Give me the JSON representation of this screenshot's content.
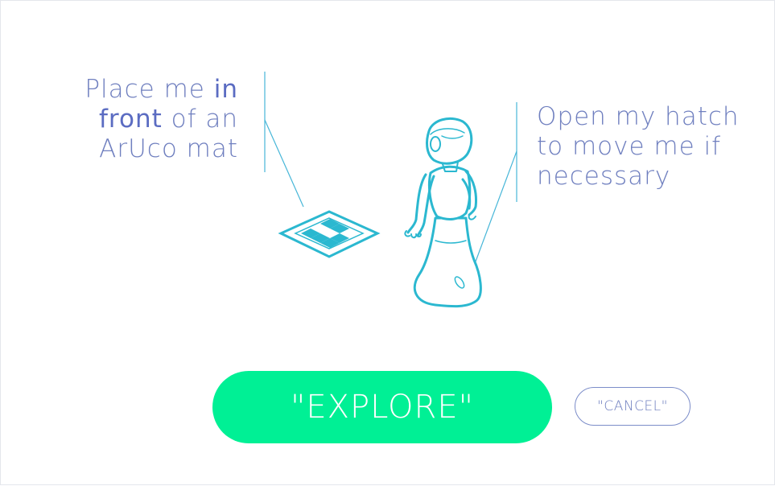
{
  "instructions": {
    "left": {
      "part1": "Place me ",
      "part2": "in",
      "part3": "front",
      "part4": " of an",
      "part5": "ArUco mat"
    },
    "right": {
      "line1": "Open my hatch",
      "line2": "to move me if",
      "line3": "necessary"
    }
  },
  "buttons": {
    "explore_label": "\"EXPLORE\"",
    "cancel_label": "\"CANCEL\""
  },
  "colors": {
    "accent_green": "#00f095",
    "text_blue": "#6f7fbf",
    "illustration_cyan": "#2bb8d0"
  },
  "icons": {
    "mat": "aruco-mat-icon",
    "robot": "pepper-robot-icon"
  }
}
